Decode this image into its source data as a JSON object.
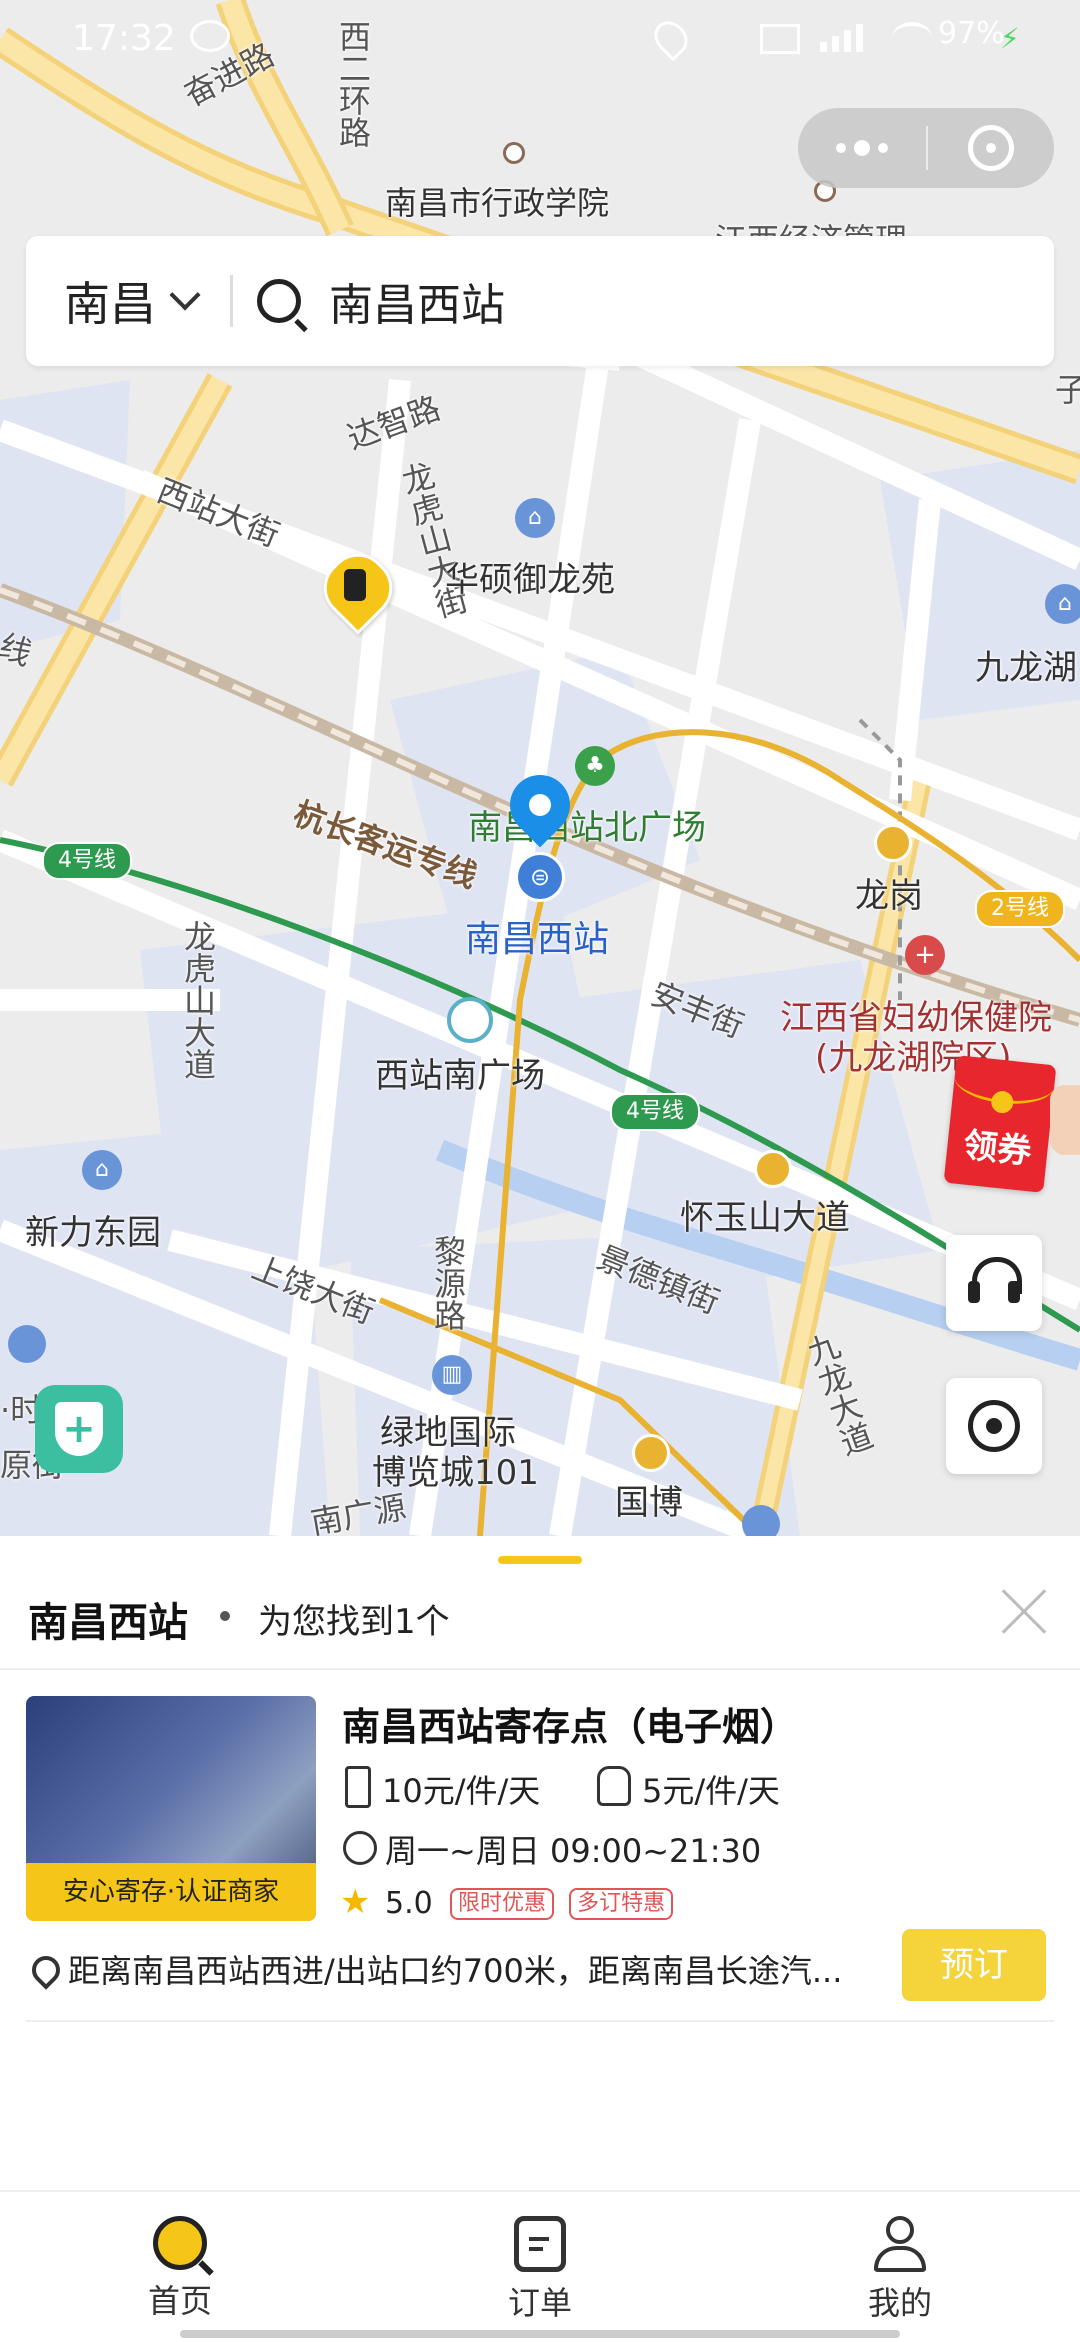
{
  "statusbar": {
    "time": "17:32",
    "battery": "97%"
  },
  "search": {
    "city": "南昌",
    "query": "南昌西站"
  },
  "map": {
    "roads": [
      "奋进路",
      "西二环路",
      "达智路",
      "西站大街",
      "龙虎山大街",
      "杭长客运专线",
      "龙虎山大道",
      "安丰街",
      "黎源路",
      "上饶大街",
      "景德镇街",
      "九龙大道",
      "南广源",
      "江西经济管理"
    ],
    "pois": [
      "南昌市行政学院",
      "华硕御龙苑",
      "九龙湖",
      "南昌西站北广场",
      "南昌西站",
      "龙岗",
      "江西省妇幼保健院",
      "(九龙湖院区)",
      "西站南广场",
      "新力东园",
      "怀玉山大道",
      "绿地国际",
      "博览城101",
      "国博"
    ],
    "metro": {
      "line4": "4号线",
      "line2": "2号线",
      "line4b": "4号线"
    },
    "coupon": "领券",
    "partial_labels": [
      "线",
      "·时",
      "原街",
      "子"
    ]
  },
  "sheet": {
    "title": "南昌西站",
    "subtitle": "为您找到1个",
    "item": {
      "name": "南昌西站寄存点（电子烟）",
      "badge": "安心寄存·认证商家",
      "price_luggage": "10元/件/天",
      "price_bag": "5元/件/天",
      "hours": "周一~周日 09:00~21:30",
      "rating": "5.0",
      "tags": [
        "限时优惠",
        "多订特惠"
      ],
      "distance": "距离南昌西站西进/出站口约700米，距离南昌长途汽...",
      "book": "预订"
    }
  },
  "tabbar": {
    "home": "首页",
    "orders": "订单",
    "mine": "我的"
  },
  "colors": {
    "accent": "#f5c518",
    "metro_green": "#2e9a4f",
    "coupon_red": "#e8262d",
    "pin_blue": "#1b8fe8"
  }
}
